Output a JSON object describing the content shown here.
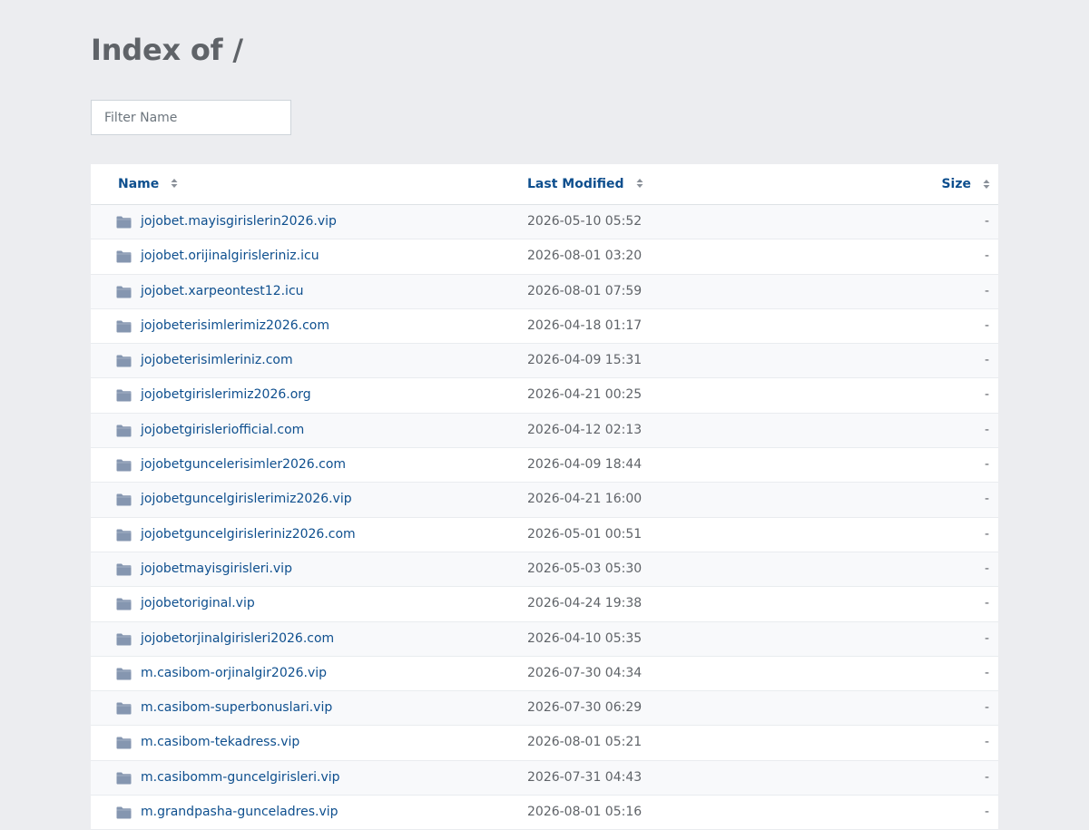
{
  "page": {
    "title": "Index of /",
    "filter_placeholder": "Filter Name"
  },
  "table": {
    "headers": {
      "name": "Name",
      "modified": "Last Modified",
      "size": "Size"
    },
    "rows": [
      {
        "name": "jojobet.mayisgirislerin2026.vip",
        "modified": "2026-05-10 05:52",
        "size": "-"
      },
      {
        "name": "jojobet.orijinalgirisleriniz.icu",
        "modified": "2026-08-01 03:20",
        "size": "-"
      },
      {
        "name": "jojobet.xarpeontest12.icu",
        "modified": "2026-08-01 07:59",
        "size": "-"
      },
      {
        "name": "jojobeterisimlerimiz2026.com",
        "modified": "2026-04-18 01:17",
        "size": "-"
      },
      {
        "name": "jojobeterisimleriniz.com",
        "modified": "2026-04-09 15:31",
        "size": "-"
      },
      {
        "name": "jojobetgirislerimiz2026.org",
        "modified": "2026-04-21 00:25",
        "size": "-"
      },
      {
        "name": "jojobetgirisleriofficial.com",
        "modified": "2026-04-12 02:13",
        "size": "-"
      },
      {
        "name": "jojobetguncelerisimler2026.com",
        "modified": "2026-04-09 18:44",
        "size": "-"
      },
      {
        "name": "jojobetguncelgirislerimiz2026.vip",
        "modified": "2026-04-21 16:00",
        "size": "-"
      },
      {
        "name": "jojobetguncelgirisleriniz2026.com",
        "modified": "2026-05-01 00:51",
        "size": "-"
      },
      {
        "name": "jojobetmayisgirisleri.vip",
        "modified": "2026-05-03 05:30",
        "size": "-"
      },
      {
        "name": "jojobetoriginal.vip",
        "modified": "2026-04-24 19:38",
        "size": "-"
      },
      {
        "name": "jojobetorjinalgirisleri2026.com",
        "modified": "2026-04-10 05:35",
        "size": "-"
      },
      {
        "name": "m.casibom-orjinalgir2026.vip",
        "modified": "2026-07-30 04:34",
        "size": "-"
      },
      {
        "name": "m.casibom-superbonuslari.vip",
        "modified": "2026-07-30 06:29",
        "size": "-"
      },
      {
        "name": "m.casibom-tekadress.vip",
        "modified": "2026-08-01 05:21",
        "size": "-"
      },
      {
        "name": "m.casibomm-guncelgirisleri.vip",
        "modified": "2026-07-31 04:43",
        "size": "-"
      },
      {
        "name": "m.grandpasha-gunceladres.vip",
        "modified": "2026-08-01 05:16",
        "size": "-"
      }
    ]
  },
  "icons": {
    "row": "folder-icon",
    "sort": "sort-icon"
  },
  "colors": {
    "link": "#0e4f8e",
    "folder": "#8596b0",
    "background": "#ecedf0"
  }
}
